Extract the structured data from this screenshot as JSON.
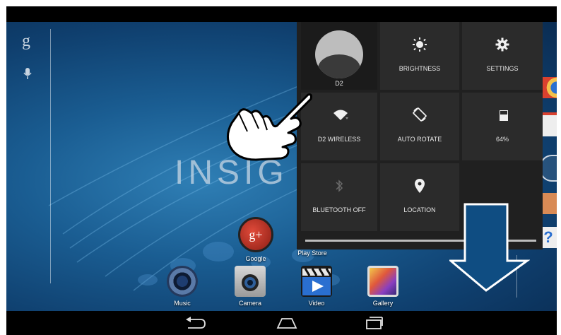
{
  "home": {
    "brand": "INSIG",
    "apps_row1": [
      {
        "label": "Google",
        "icon": "google-plus-icon"
      },
      {
        "label": "Play Store",
        "icon": "play-store-icon"
      }
    ],
    "dock": [
      {
        "label": "Music",
        "icon": "music-icon"
      },
      {
        "label": "Camera",
        "icon": "camera-icon"
      },
      {
        "label": "Video",
        "icon": "video-icon"
      },
      {
        "label": "Gallery",
        "icon": "gallery-icon"
      }
    ]
  },
  "quick_settings": {
    "user": {
      "label": "D2"
    },
    "brightness": {
      "label": "BRIGHTNESS",
      "icon": "brightness-icon"
    },
    "settings": {
      "label": "SETTINGS",
      "icon": "gear-icon"
    },
    "wifi": {
      "label": "D2 WIRELESS",
      "icon": "wifi-icon"
    },
    "rotate": {
      "label": "AUTO ROTATE",
      "icon": "auto-rotate-icon"
    },
    "battery": {
      "label": "64%",
      "icon": "battery-icon",
      "level": 0.64
    },
    "bluetooth": {
      "label": "BLUETOOTH OFF",
      "icon": "bluetooth-icon"
    },
    "location": {
      "label": "LOCATION",
      "icon": "location-pin-icon"
    }
  },
  "navigation": {
    "back": "back-icon",
    "home": "home-icon",
    "recents": "recents-icon"
  },
  "colors": {
    "arrow": "#0f4d82",
    "tile": "#2b2b2b",
    "panel": "#202020"
  }
}
